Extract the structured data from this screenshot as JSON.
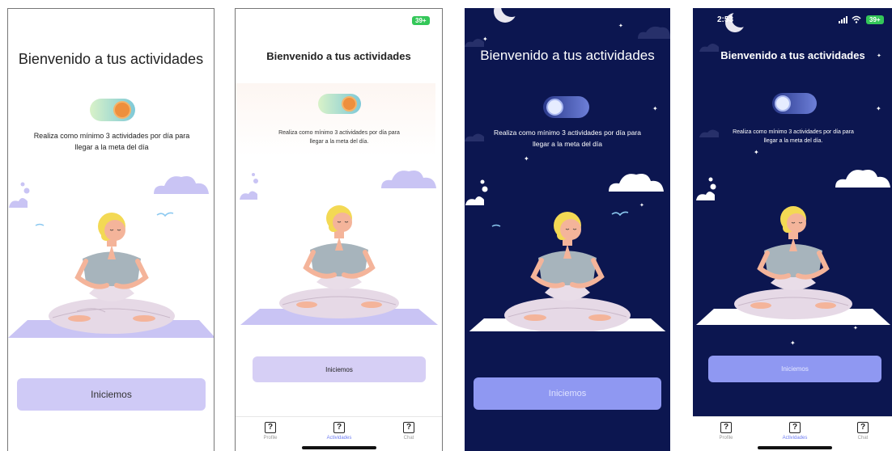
{
  "screens": [
    {
      "title": "Bienvenido a tus actividades",
      "subtitle": "Realiza como mínimo 3 actividades por día para llegar a la meta del día",
      "button": "Iniciemos"
    },
    {
      "status": {
        "battery": "39+"
      },
      "title": "Bienvenido a tus actividades",
      "subtitle": "Realiza como mínimo 3 actividades por día para llegar a la meta del día.",
      "button": "Iniciemos",
      "tabs": [
        "Profile",
        "Actividades",
        "Chat"
      ]
    },
    {
      "title": "Bienvenido a tus actividades",
      "subtitle": "Realiza como mínimo 3 actividades por día para llegar a la meta del día",
      "button": "Iniciemos"
    },
    {
      "status": {
        "time": "2:53",
        "battery": "39+"
      },
      "title": "Bienvenido a tus actividades",
      "subtitle": "Realiza como mínimo 3 actividades por día para llegar a la meta del día.",
      "button": "Iniciemos",
      "tabs": [
        "Profile",
        "Actividades",
        "Chat"
      ]
    }
  ],
  "tab_icon_glyph": "?",
  "colors": {
    "dark_bg": "#0c1650",
    "lavender": "#c9c4f4",
    "lavender_button": "#d4cdf5",
    "periwinkle_button": "#8f98f2",
    "active_tab": "#6c7bf2",
    "battery_green": "#34c759"
  },
  "icons": {
    "toggle_light": "sun-toggle-icon",
    "toggle_dark": "moon-toggle-icon",
    "moon": "crescent-moon-icon",
    "signal": "signal-bars-icon",
    "wifi": "wifi-icon",
    "tab": "question-box-icon"
  }
}
